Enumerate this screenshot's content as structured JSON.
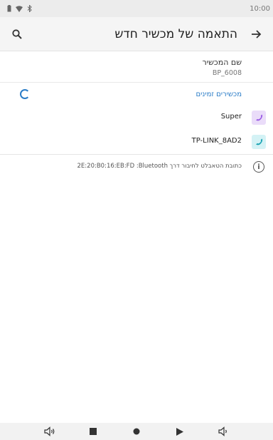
{
  "status_bar": {
    "time": "10:00",
    "icons": [
      "battery-icon",
      "wifi-icon",
      "bluetooth-icon"
    ]
  },
  "app_bar": {
    "title": "התאמה של מכשיר חדש",
    "back_icon": "arrow-back-icon",
    "search_icon": "search-icon"
  },
  "device_name": {
    "label": "שם המכשיר",
    "value": "BP_6008"
  },
  "available_devices": {
    "header": "מכשירים זמינים",
    "items": [
      {
        "name": "Super",
        "icon": "phone-icon",
        "icon_color": "#9b5de5",
        "icon_bg": "#eadcf9"
      },
      {
        "name": "TP-LINK_8AD2",
        "icon": "phone-icon",
        "icon_color": "#1aa3b3",
        "icon_bg": "#d4f2f5"
      }
    ]
  },
  "info": {
    "text": "כתובת הטאבלט לחיבור דרך Bluetooth:‏ 2E:20:B0:16:EB:FD"
  },
  "nav_bar": {
    "items": [
      "volume-down-icon",
      "stop-icon",
      "home-icon",
      "play-icon",
      "volume-up-icon"
    ]
  },
  "colors": {
    "accent": "#2a7cc7",
    "status_bar_bg": "#ececec",
    "app_bar_bg": "#f5f5f5"
  }
}
